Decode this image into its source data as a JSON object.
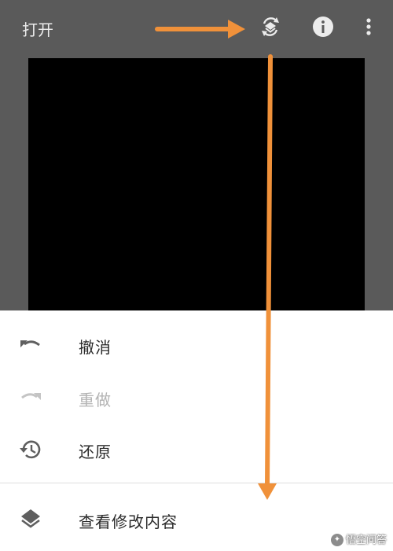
{
  "header": {
    "open_label": "打开",
    "icons": [
      "history-layers-icon",
      "info-icon",
      "more-vertical-icon"
    ]
  },
  "menu": {
    "undo_label": "撤消",
    "redo_label": "重做",
    "revert_label": "还原",
    "view_edits_label": "查看修改内容"
  },
  "watermark": {
    "text": "悟空问答"
  },
  "colors": {
    "toolbar_bg": "#5a5a5a",
    "sheet_bg": "#ffffff",
    "annotation_arrow": "#f0913a",
    "disabled_text": "#b3b3b3"
  }
}
